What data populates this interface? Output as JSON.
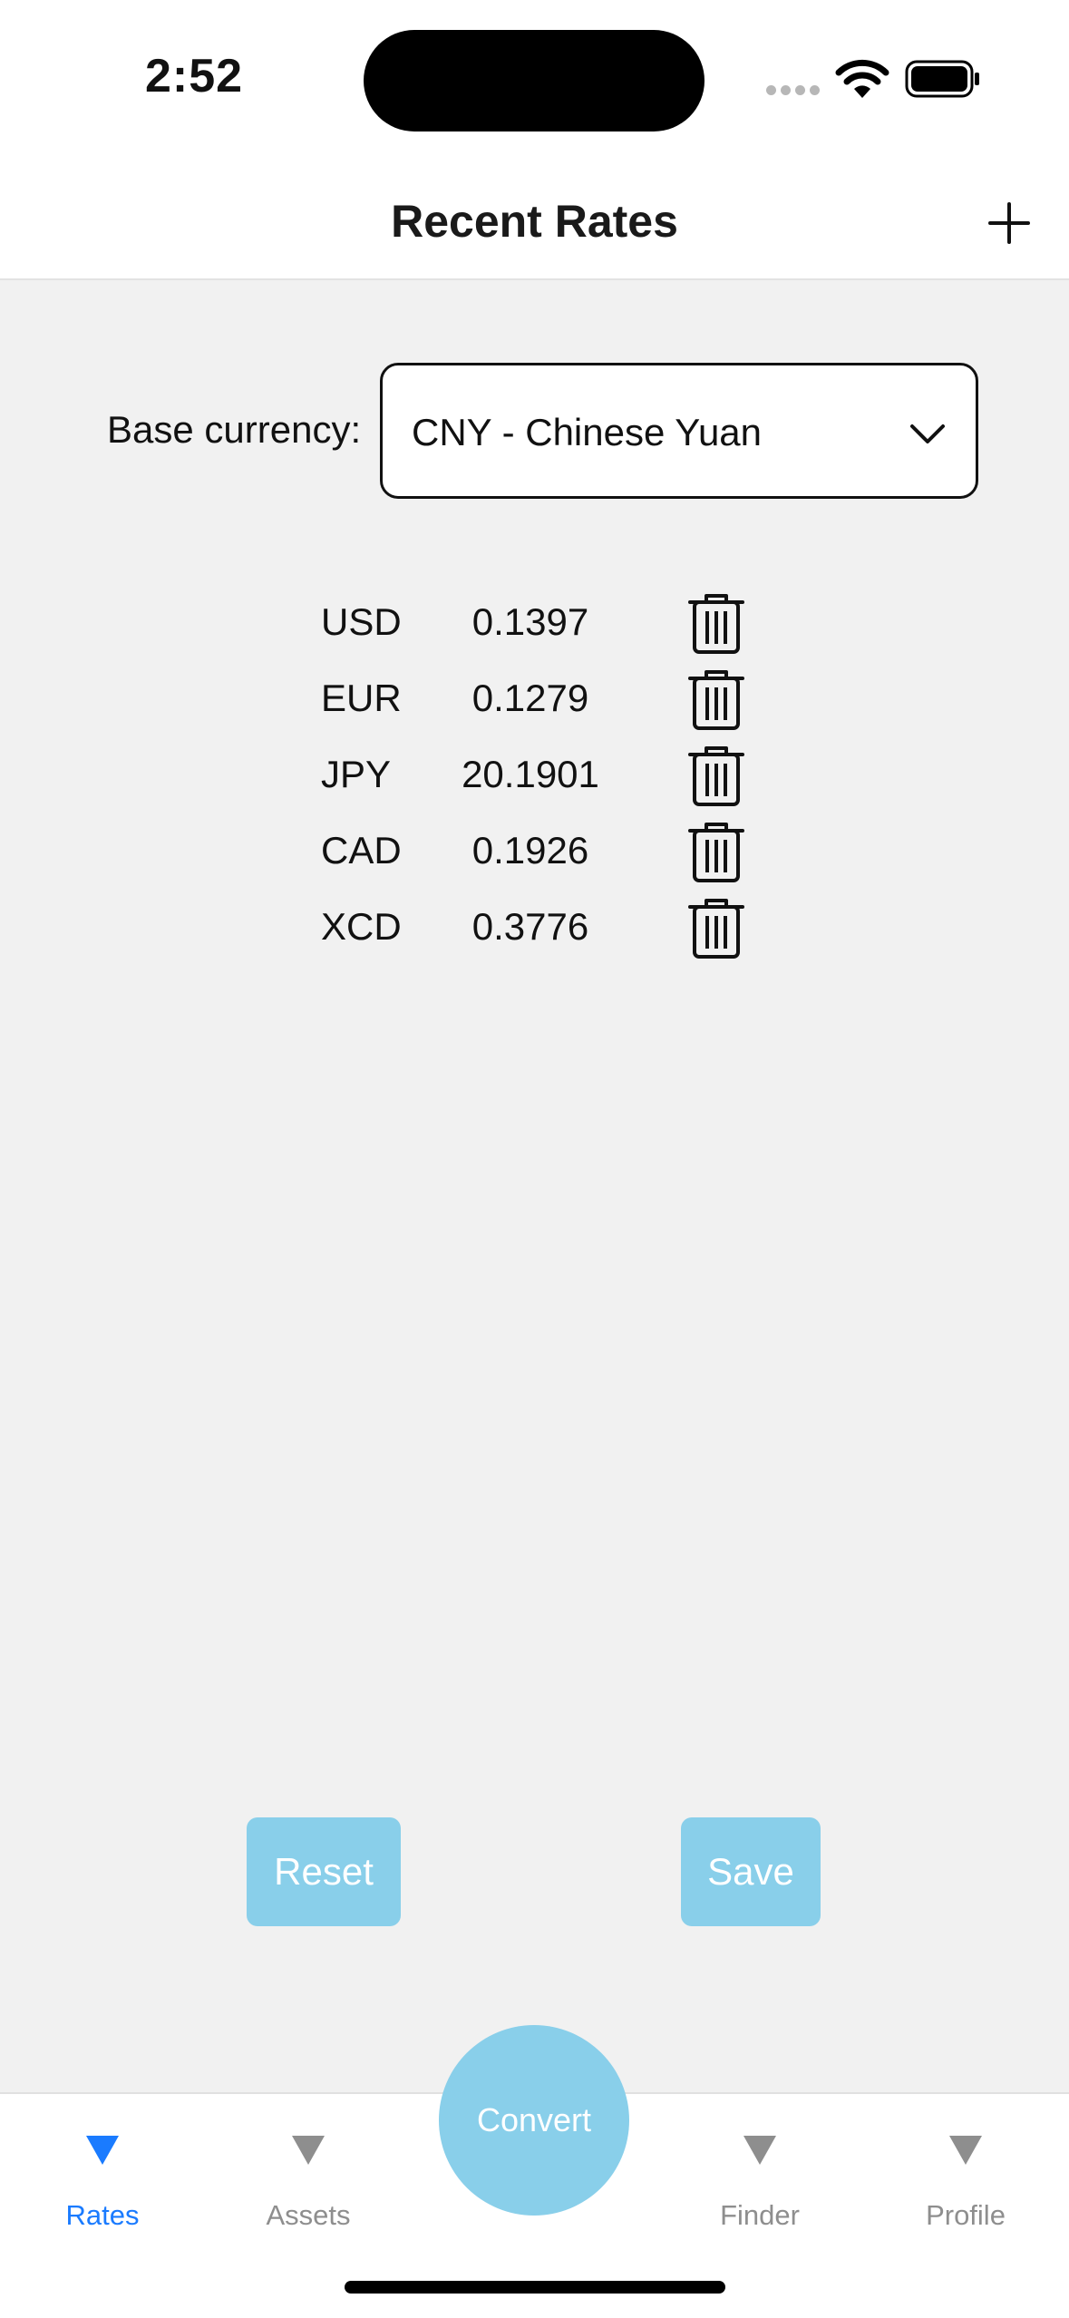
{
  "status_bar": {
    "time": "2:52"
  },
  "header": {
    "title": "Recent Rates",
    "add_icon": "plus-icon"
  },
  "base_currency": {
    "label": "Base currency:",
    "selected": "CNY - Chinese Yuan"
  },
  "rates": [
    {
      "code": "USD",
      "value": "0.1397"
    },
    {
      "code": "EUR",
      "value": "0.1279"
    },
    {
      "code": "JPY",
      "value": "20.1901"
    },
    {
      "code": "CAD",
      "value": "0.1926"
    },
    {
      "code": "XCD",
      "value": "0.3776"
    }
  ],
  "actions": {
    "reset_label": "Reset",
    "save_label": "Save"
  },
  "tabbar": {
    "tabs": [
      {
        "label": "Rates",
        "active": true
      },
      {
        "label": "Assets",
        "active": false
      },
      {
        "label": "Finder",
        "active": false
      },
      {
        "label": "Profile",
        "active": false
      }
    ],
    "convert_label": "Convert"
  },
  "colors": {
    "accent": "#1a7bff",
    "button_fill": "#89cfea",
    "background": "#f1f1f1",
    "inactive_tab": "#8e8e8e"
  }
}
